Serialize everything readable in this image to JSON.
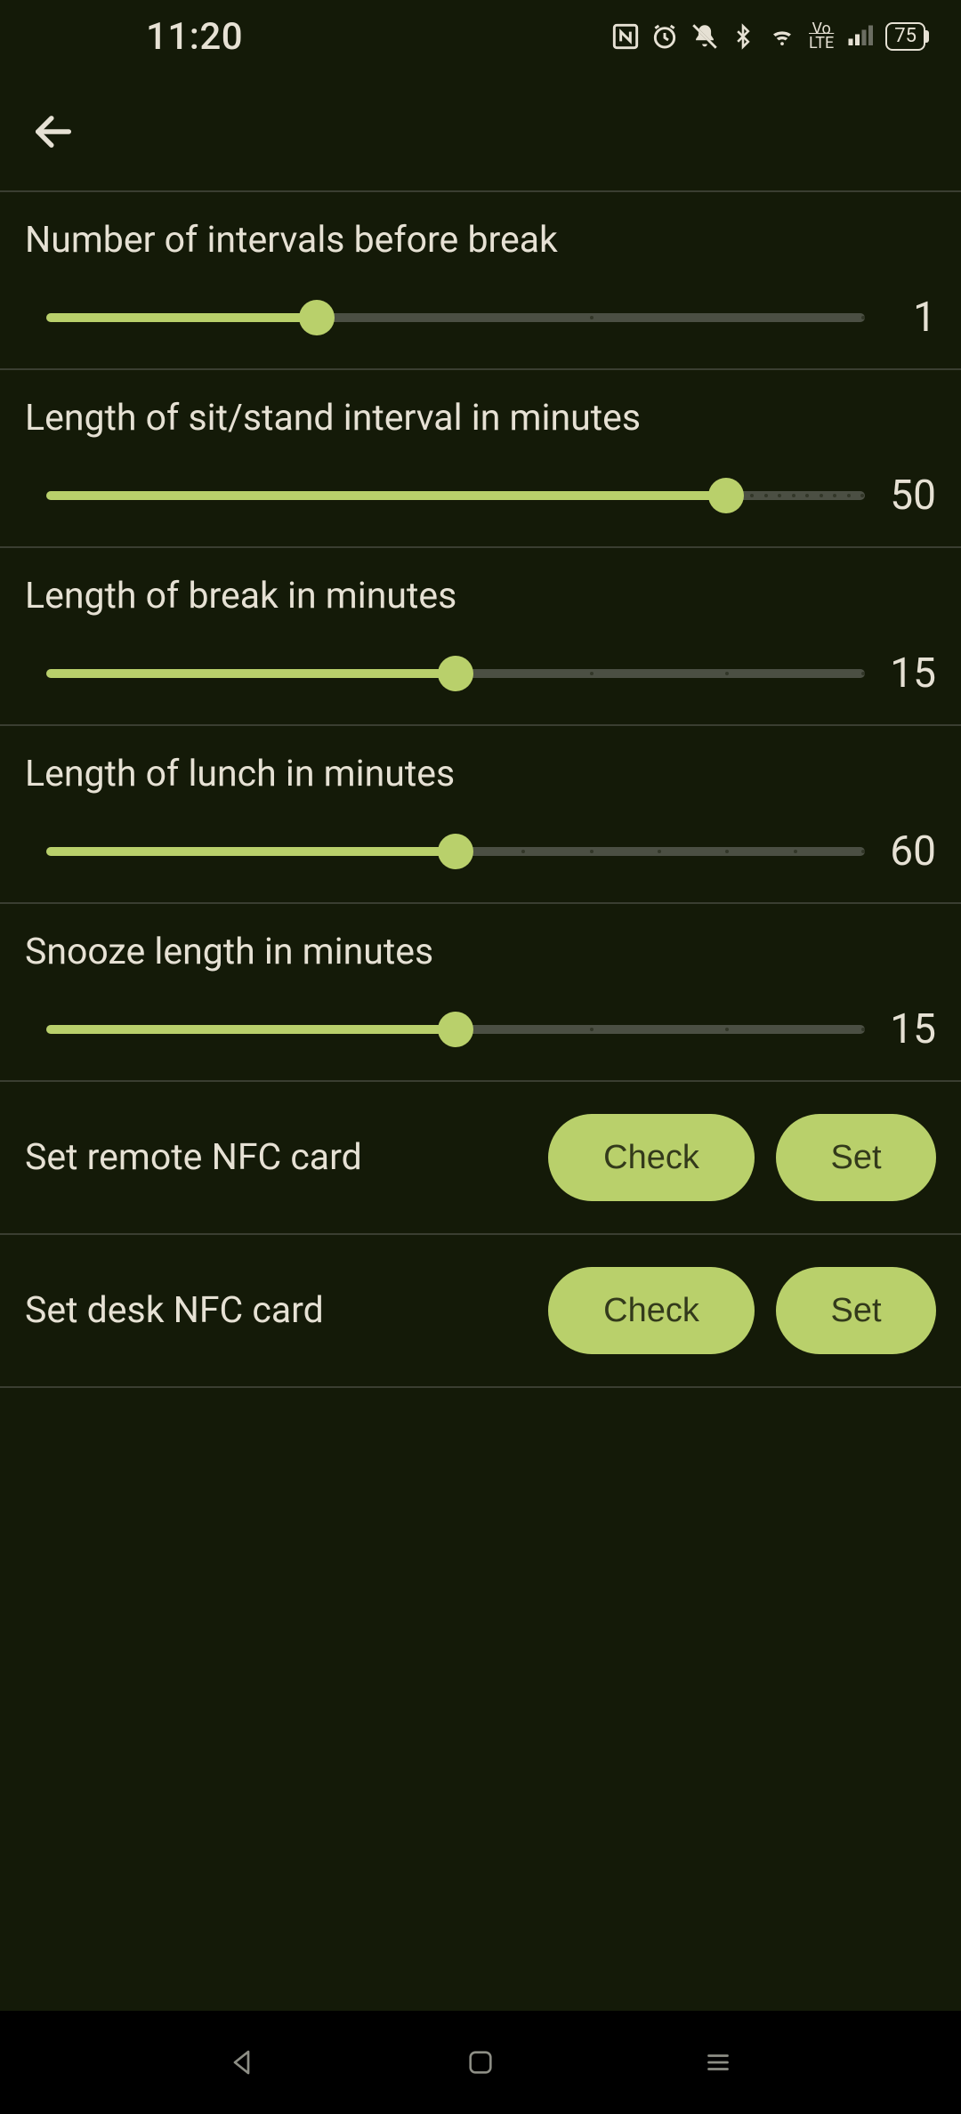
{
  "statusbar": {
    "time": "11:20",
    "battery": "75"
  },
  "settings": {
    "intervals_before_break": {
      "label": "Number of intervals before break",
      "value": "1",
      "percent": 33,
      "tick_count": 4
    },
    "sit_stand_minutes": {
      "label": "Length of sit/stand interval in minutes",
      "value": "50",
      "percent": 83,
      "tick_count": 60
    },
    "break_minutes": {
      "label": "Length of break in minutes",
      "value": "15",
      "percent": 50,
      "tick_count": 7
    },
    "lunch_minutes": {
      "label": "Length of lunch in minutes",
      "value": "60",
      "percent": 50,
      "tick_count": 13
    },
    "snooze_minutes": {
      "label": "Snooze length in minutes",
      "value": "15",
      "percent": 50,
      "tick_count": 7
    }
  },
  "nfc": {
    "remote": {
      "label": "Set remote NFC card",
      "check_label": "Check",
      "set_label": "Set"
    },
    "desk": {
      "label": "Set desk NFC card",
      "check_label": "Check",
      "set_label": "Set"
    }
  }
}
